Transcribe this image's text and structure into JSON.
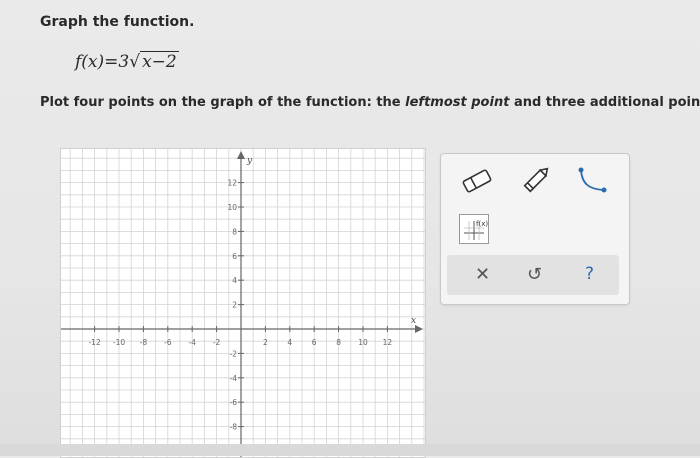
{
  "heading": "Graph the function.",
  "function": {
    "lhs": "f(x)=3",
    "radicand": "x−2"
  },
  "instruction": {
    "before": "Plot four points on the graph of the function: the ",
    "emphasis": "leftmost point",
    "after": " and three additional points. T"
  },
  "graph": {
    "x_axis_label": "x",
    "y_axis_label": "y",
    "x_tick_labels": [
      "-12",
      "-10",
      "-8",
      "-6",
      "-4",
      "-2",
      "2",
      "4",
      "6",
      "8",
      "10",
      "12"
    ],
    "y_tick_labels": [
      "12",
      "10",
      "8",
      "6",
      "4",
      "2",
      "-2",
      "-4",
      "-6",
      "-8"
    ]
  },
  "tools": {
    "items": [
      {
        "name": "eraser-icon"
      },
      {
        "name": "pencil-icon"
      },
      {
        "name": "curve-tool-icon"
      },
      {
        "name": "function-tool-icon"
      }
    ],
    "actions": [
      {
        "name": "clear-button",
        "glyph": "✕"
      },
      {
        "name": "undo-button",
        "glyph": "↺"
      },
      {
        "name": "help-button",
        "glyph": "?"
      }
    ]
  },
  "colors": {
    "grid": "#d4d4d4",
    "axis": "#666666",
    "help": "#2b6cb0"
  }
}
